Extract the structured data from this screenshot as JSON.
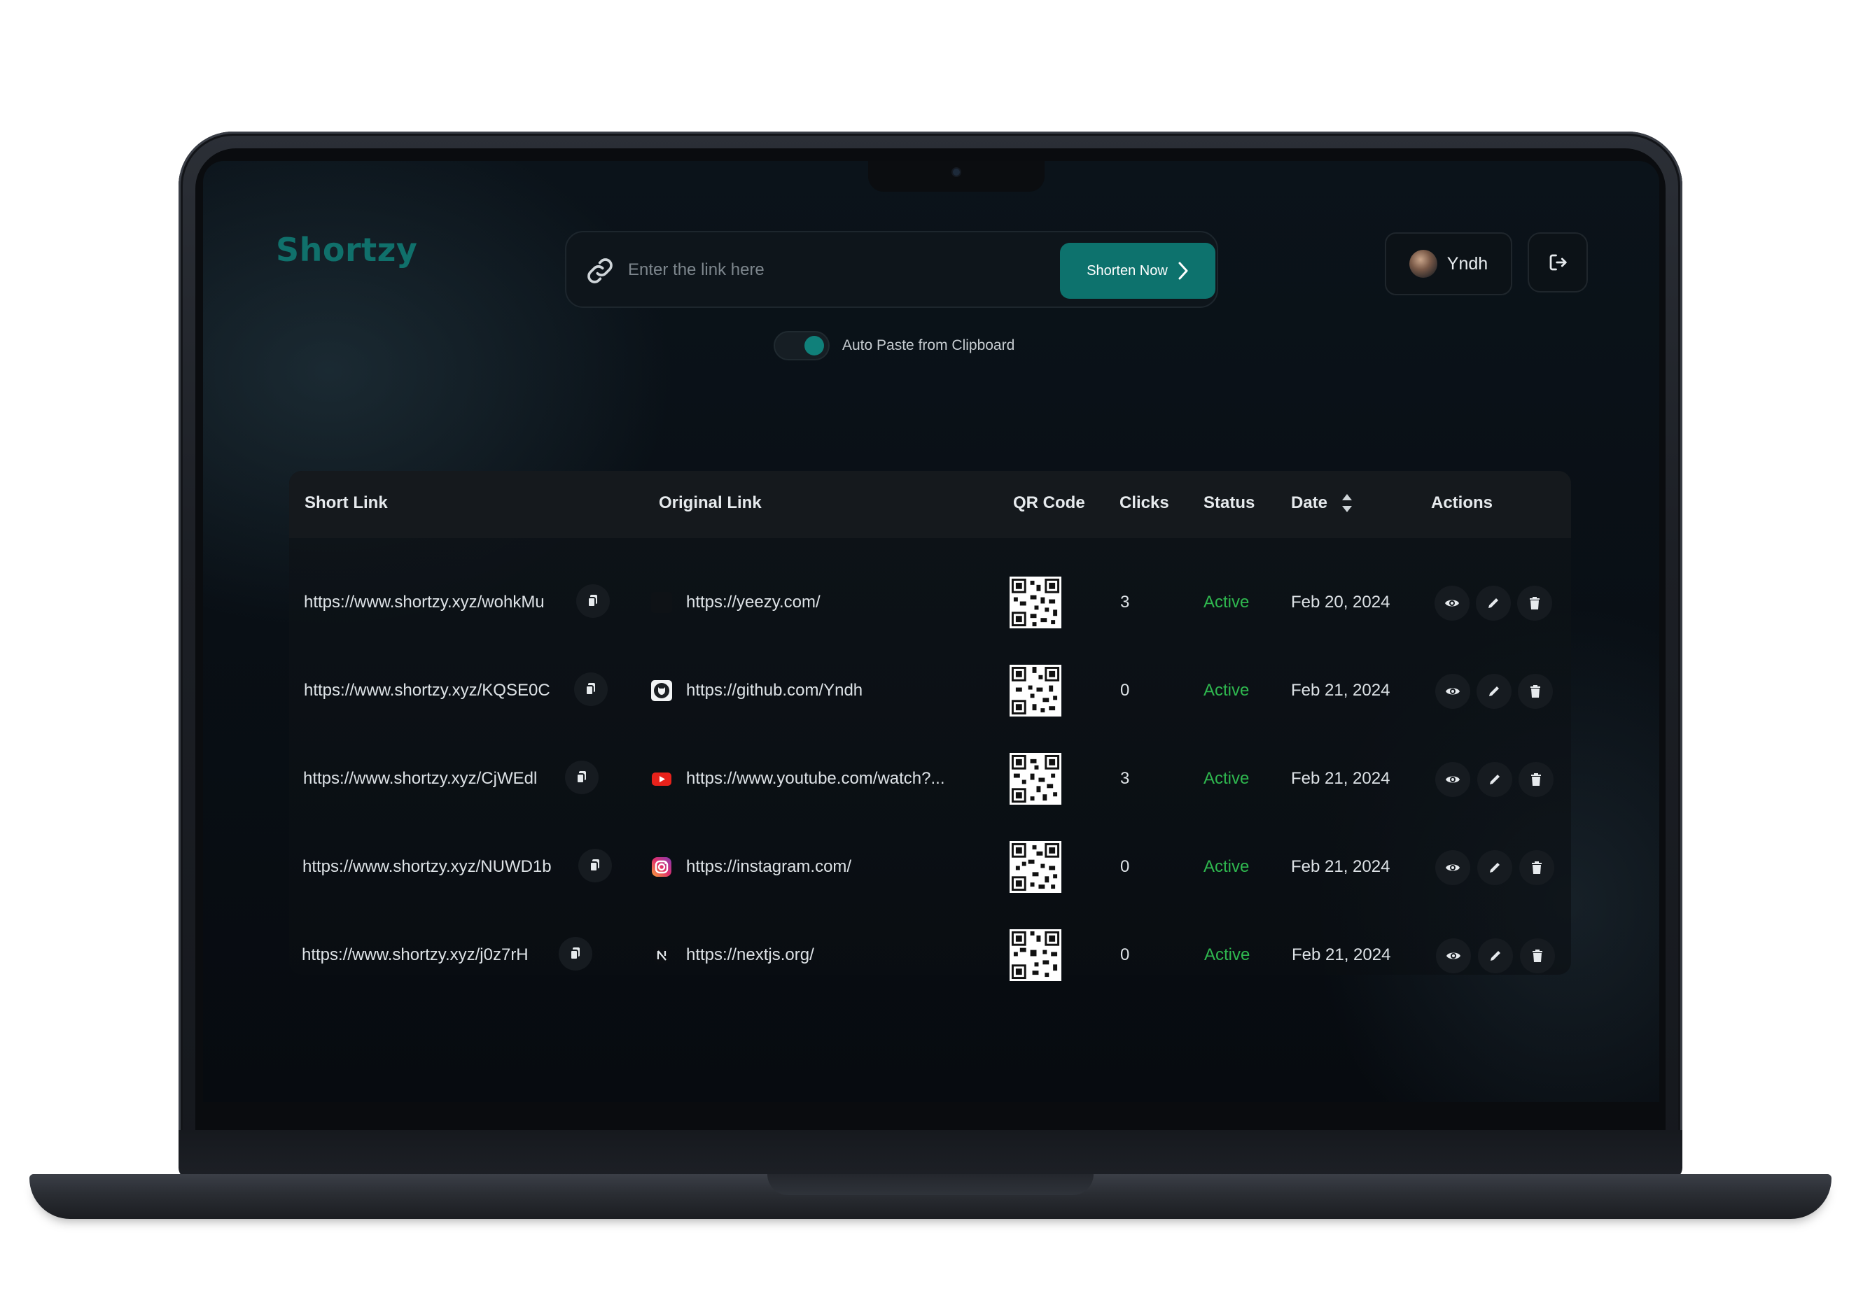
{
  "app": {
    "name": "Shortzy",
    "accent": "#0d726d"
  },
  "search": {
    "placeholder": "Enter the link here",
    "value": "",
    "button_label": "Shorten Now"
  },
  "toggle": {
    "label": "Auto Paste from Clipboard",
    "on": true
  },
  "user": {
    "name": "Yndh"
  },
  "table": {
    "headers": {
      "short": "Short Link",
      "original": "Original Link",
      "qr": "QR Code",
      "clicks": "Clicks",
      "status": "Status",
      "date": "Date",
      "actions": "Actions"
    },
    "rows": [
      {
        "short": "https://www.shortzy.xyz/wohkMu",
        "original": "https://yeezy.com/",
        "favicon": "yeezy-icon",
        "clicks": "3",
        "status": "Active",
        "date": "Feb 20, 2024"
      },
      {
        "short": "https://www.shortzy.xyz/KQSE0C",
        "original": "https://github.com/Yndh",
        "favicon": "github-icon",
        "clicks": "0",
        "status": "Active",
        "date": "Feb 21, 2024"
      },
      {
        "short": "https://www.shortzy.xyz/CjWEdl",
        "original": "https://www.youtube.com/watch?...",
        "favicon": "youtube-icon",
        "clicks": "3",
        "status": "Active",
        "date": "Feb 21, 2024"
      },
      {
        "short": "https://www.shortzy.xyz/NUWD1b",
        "original": "https://instagram.com/",
        "favicon": "instagram-icon",
        "clicks": "0",
        "status": "Active",
        "date": "Feb 21, 2024"
      },
      {
        "short": "https://www.shortzy.xyz/j0z7rH",
        "original": "https://nextjs.org/",
        "favicon": "nextjs-icon",
        "clicks": "0",
        "status": "Active",
        "date": "Feb 21, 2024"
      }
    ]
  },
  "colors": {
    "status_active": "#2fb84f"
  }
}
